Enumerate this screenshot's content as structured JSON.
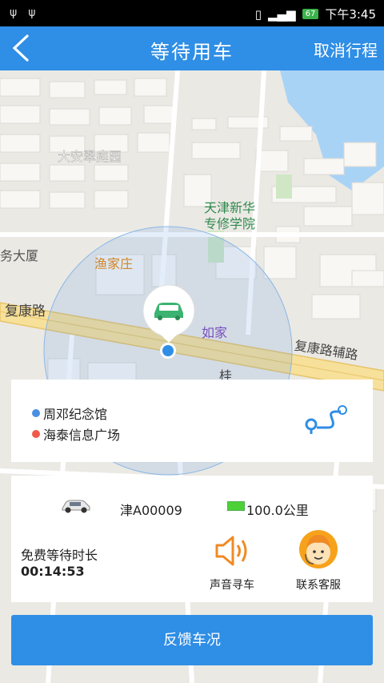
{
  "status_bar": {
    "time": "下午3:45",
    "battery": "67"
  },
  "nav": {
    "title": "等待用车",
    "cancel_label": "取消行程"
  },
  "map": {
    "labels": {
      "community": "大安翠庭园",
      "school_line1": "天津新华",
      "school_line2": "专修学院",
      "building_left": "务大厦",
      "restaurant": "渔家庄",
      "road_main": "复康路",
      "hotel": "如家",
      "road_aux": "复康路辅路",
      "partial": "桂"
    }
  },
  "route": {
    "start": "周邓纪念馆",
    "end": "海泰信息广场",
    "start_color": "#4a90e2",
    "end_color": "#f05a4a"
  },
  "vehicle": {
    "plate": "津A00009",
    "range": "100.0公里"
  },
  "waiting": {
    "label": "免费等待时长",
    "time": "00:14:53"
  },
  "actions": {
    "sound_label": "声音寻车",
    "service_label": "联系客服"
  },
  "feedback_label": "反馈车况",
  "colors": {
    "primary": "#2f8ee5",
    "accent": "#f08a24"
  }
}
